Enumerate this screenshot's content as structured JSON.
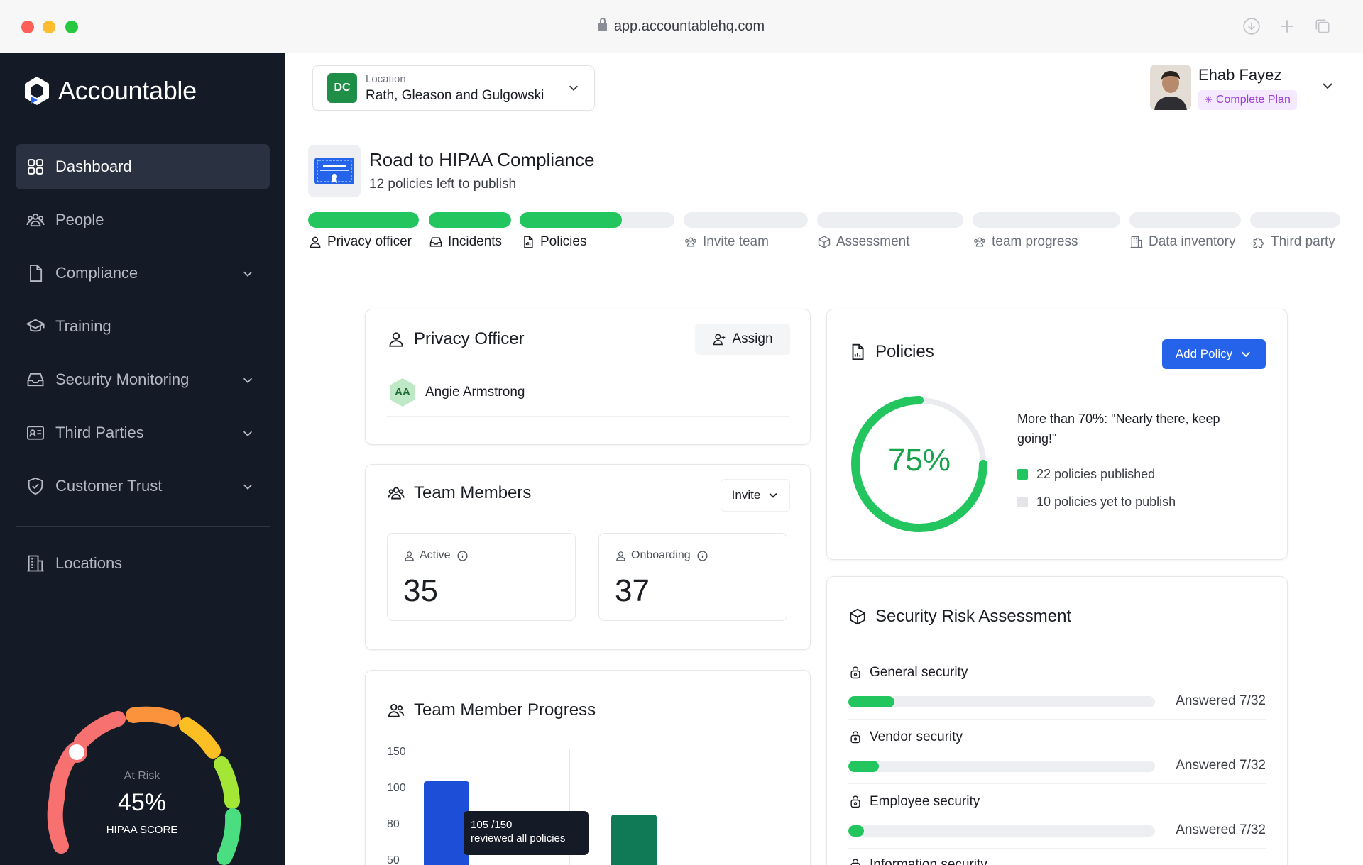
{
  "browser": {
    "url": "app.accountablehq.com"
  },
  "brand": {
    "name": "Accountable"
  },
  "sidebar": {
    "items": [
      {
        "label": "Dashboard",
        "icon": "grid-icon",
        "active": true
      },
      {
        "label": "People",
        "icon": "people-icon"
      },
      {
        "label": "Compliance",
        "icon": "document-icon",
        "expandable": true
      },
      {
        "label": "Training",
        "icon": "graduation-cap-icon"
      },
      {
        "label": "Security Monitoring",
        "icon": "inbox-icon",
        "expandable": true
      },
      {
        "label": "Third Parties",
        "icon": "id-card-icon",
        "expandable": true
      },
      {
        "label": "Customer Trust",
        "icon": "shield-check-icon",
        "expandable": true
      },
      {
        "label": "Locations",
        "icon": "building-icon"
      }
    ]
  },
  "score": {
    "status": "At Risk",
    "value": "45%",
    "label": "HIPAA SCORE",
    "min": "0",
    "max": "100",
    "percent": 45
  },
  "header": {
    "location": {
      "badge": "DC",
      "label": "Location",
      "value": "Rath, Gleason and Gulgowski"
    },
    "user": {
      "name": "Ehab Fayez",
      "plan": "Complete Plan"
    }
  },
  "hero": {
    "title": "Road to HIPAA Compliance",
    "subtitle": "12 policies left to publish",
    "steps": [
      {
        "label": "Privacy officer",
        "icon": "user-icon",
        "progress": 1.0
      },
      {
        "label": "Incidents",
        "icon": "inbox-icon",
        "progress": 1.0
      },
      {
        "label": "Policies",
        "icon": "document-icon",
        "progress": 0.66
      },
      {
        "label": "Invite team",
        "icon": "people-icon",
        "progress": 0
      },
      {
        "label": "Assessment",
        "icon": "cube-icon",
        "progress": 0
      },
      {
        "label": "team progress",
        "icon": "people-icon",
        "progress": 0
      },
      {
        "label": "Data inventory",
        "icon": "building-icon",
        "progress": 0
      },
      {
        "label": "Third party",
        "icon": "puzzle-icon",
        "progress": 0
      }
    ]
  },
  "privacy_officer": {
    "title": "Privacy Officer",
    "assign_label": "Assign",
    "person": {
      "initials": "AA",
      "name": "Angie Armstrong"
    }
  },
  "team_members": {
    "title": "Team Members",
    "invite_label": "Invite",
    "active": {
      "label": "Active",
      "value": "35"
    },
    "onboarding": {
      "label": "Onboarding",
      "value": "37"
    }
  },
  "team_progress": {
    "title": "Team Member Progress",
    "y_ticks": [
      "150",
      "100",
      "80",
      "50"
    ],
    "tooltip": {
      "line1": "105 /150",
      "line2": "reviewed all policies"
    },
    "colors": {
      "bar1": "#1d4ed8",
      "bar2": "#0f7a55"
    }
  },
  "policies": {
    "title": "Policies",
    "add_label": "Add Policy",
    "percent_label": "75%",
    "percent": 75,
    "message": "More than 70%: \"Nearly there, keep going!\"",
    "published": "22 policies published",
    "unpublished": "10 policies yet to publish"
  },
  "security_risk": {
    "title": "Security Risk Assessment",
    "rows": [
      {
        "label": "General security",
        "answered": "Answered 7/32",
        "progress": 0.15
      },
      {
        "label": "Vendor security",
        "answered": "Answered 7/32",
        "progress": 0.1
      },
      {
        "label": "Employee security",
        "answered": "Answered 7/32",
        "progress": 0.05
      },
      {
        "label": "Information security"
      }
    ]
  },
  "colors": {
    "accent_green": "#22c55e",
    "primary_blue": "#2563eb",
    "sidebar_bg": "#141a26"
  }
}
